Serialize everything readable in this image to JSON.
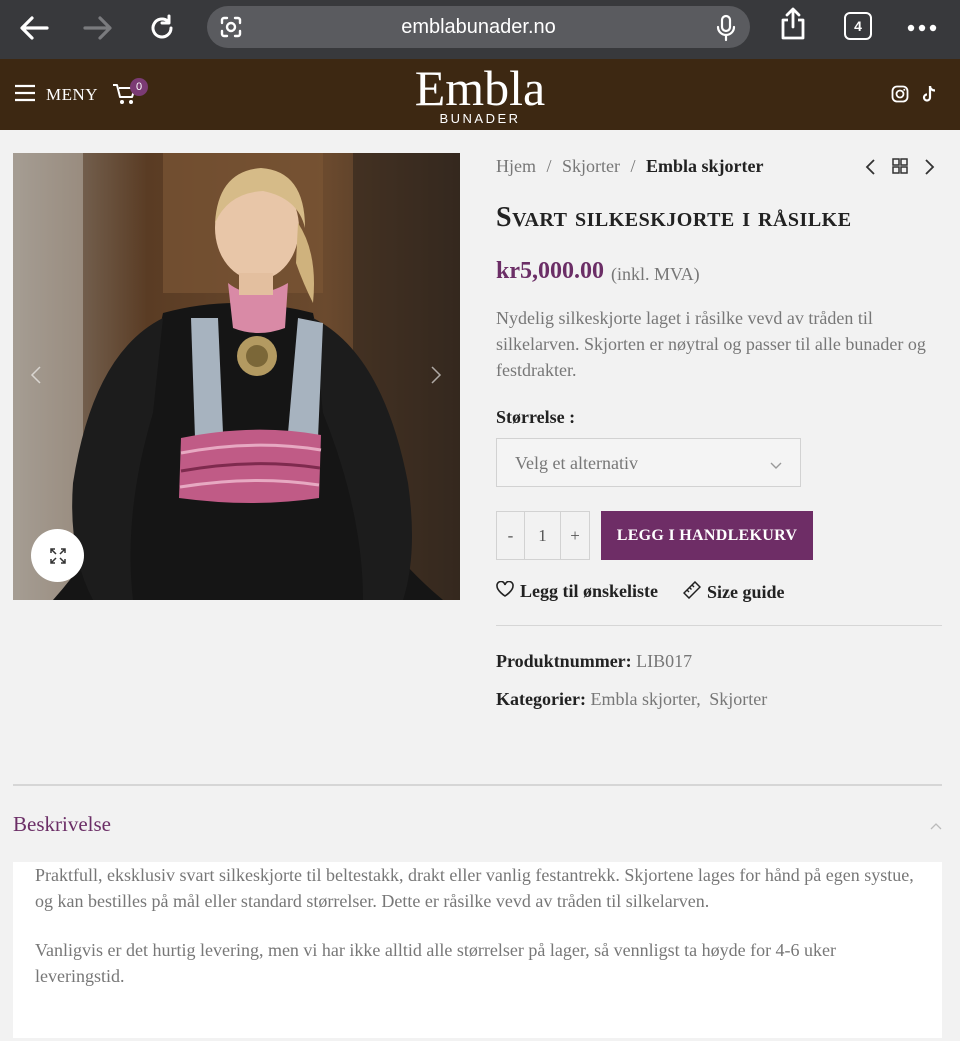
{
  "browser": {
    "url": "emblabunader.no",
    "tab_count": "4"
  },
  "header": {
    "menu_label": "MENY",
    "cart_count": "0",
    "logo_main": "Embla",
    "logo_sub": "BUNADER"
  },
  "breadcrumb": {
    "home": "Hjem",
    "sep": " / ",
    "category": "Skjorter",
    "current": "Embla skjorter"
  },
  "product": {
    "title": "Svart silkeskjorte i råsilke",
    "price": "kr5,000.00",
    "price_suffix": "(inkl. MVA)",
    "short_description": "Nydelig silkeskjorte laget i råsilke vevd av tråden til silkelarven. Skjorten er nøytral og passer til alle bunader og festdrakter.",
    "size_label": "Størrelse :",
    "size_placeholder": "Velg et alternativ",
    "qty_minus": "-",
    "qty_value": "1",
    "qty_plus": "+",
    "add_to_cart": "LEGG I HANDLEKURV",
    "wishlist": "Legg til ønskeliste",
    "size_guide": "Size guide",
    "sku_label": "Produktnummer:",
    "sku_value": "LIB017",
    "categories_label": "Kategorier:",
    "category_1": "Embla skjorter",
    "category_sep": ",",
    "category_2": "Skjorter"
  },
  "description": {
    "tab_label": "Beskrivelse",
    "paragraph_1": "Praktfull, eksklusiv svart silkeskjorte til beltestakk, drakt eller vanlig festantrekk. Skjortene lages for hånd på egen systue, og kan bestilles på mål eller standard størrelser. Dette er råsilke vevd av tråden til silkelarven.",
    "paragraph_2": "Vanligvis er det hurtig levering, men vi har ikke alltid alle størrelser på lager, så vennligst ta høyde for 4-6 uker leveringstid."
  },
  "colors": {
    "brand_purple": "#6e2d66",
    "header_brown": "#3d2812",
    "browser_bar": "#38393c"
  },
  "icons": [
    "back-icon",
    "forward-icon",
    "reload-icon",
    "site-settings-icon",
    "microphone-icon",
    "share-icon",
    "tabs-icon",
    "more-icon",
    "hamburger-icon",
    "cart-icon",
    "instagram-icon",
    "tiktok-icon",
    "expand-icon",
    "chevron-left-icon",
    "chevron-right-icon",
    "grid-icon",
    "chevron-down-icon",
    "heart-icon",
    "ruler-icon",
    "chevron-up-icon"
  ]
}
